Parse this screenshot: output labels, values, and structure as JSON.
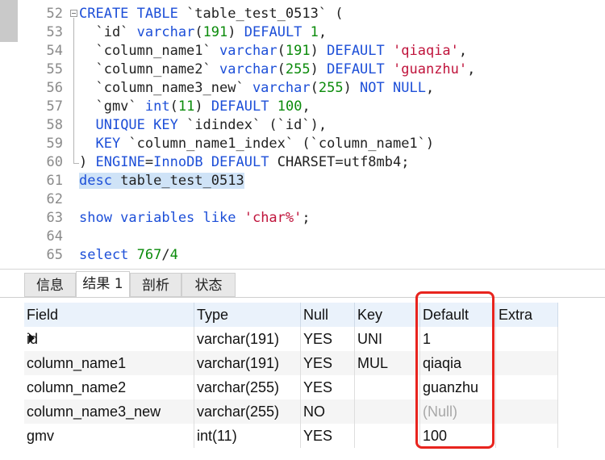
{
  "editor": {
    "lines": [
      {
        "n": "52",
        "html": "<span class='kw'>CREATE TABLE</span> `table_test_0513` ("
      },
      {
        "n": "53",
        "html": "  `id` <span class='kw'>varchar</span>(<span class='num'>191</span>) <span class='kw'>DEFAULT</span> <span class='num'>1</span>,"
      },
      {
        "n": "54",
        "html": "  `column_name1` <span class='kw'>varchar</span>(<span class='num'>191</span>) <span class='kw'>DEFAULT</span> <span class='str'>'qiaqia'</span>,"
      },
      {
        "n": "55",
        "html": "  `column_name2` <span class='kw'>varchar</span>(<span class='num'>255</span>) <span class='kw'>DEFAULT</span> <span class='str'>'guanzhu'</span>,"
      },
      {
        "n": "56",
        "html": "  `column_name3_new` <span class='kw'>varchar</span>(<span class='num'>255</span>) <span class='kw'>NOT NULL</span>,"
      },
      {
        "n": "57",
        "html": "  `gmv` <span class='kw'>int</span>(<span class='num'>11</span>) <span class='kw'>DEFAULT</span> <span class='num'>100</span>,"
      },
      {
        "n": "58",
        "html": "  <span class='kw'>UNIQUE KEY</span> `idindex` (`id`),"
      },
      {
        "n": "59",
        "html": "  <span class='kw'>KEY</span> `column_name1_index` (`column_name1`)"
      },
      {
        "n": "60",
        "html": ") <span class='kw'>ENGINE</span>=<span class='kw'>InnoDB</span> <span class='kw'>DEFAULT</span> CHARSET=utf8mb4;"
      },
      {
        "n": "61",
        "html": "<span class='hl'><span class='kw'>desc</span> table_test_0513</span>"
      },
      {
        "n": "62",
        "html": ""
      },
      {
        "n": "63",
        "html": "<span class='kw'>show variables like</span> <span class='str'>'char%'</span>;"
      },
      {
        "n": "64",
        "html": ""
      },
      {
        "n": "65",
        "html": "<span class='kw'>select</span> <span class='num'>767</span>/<span class='num'>4</span>"
      }
    ]
  },
  "tabs": [
    "信息",
    "结果 1",
    "剖析",
    "状态"
  ],
  "active_tab": "结果 1",
  "grid": {
    "columns": [
      "Field",
      "Type",
      "Null",
      "Key",
      "Default",
      "Extra"
    ],
    "rows": [
      [
        "id",
        "varchar(191)",
        "YES",
        "UNI",
        "1",
        ""
      ],
      [
        "column_name1",
        "varchar(191)",
        "YES",
        "MUL",
        "qiaqia",
        ""
      ],
      [
        "column_name2",
        "varchar(255)",
        "YES",
        "",
        "guanzhu",
        ""
      ],
      [
        "column_name3_new",
        "varchar(255)",
        "NO",
        "",
        "(Null)",
        ""
      ],
      [
        "gmv",
        "int(11)",
        "YES",
        "",
        "100",
        ""
      ]
    ]
  },
  "highlight_color": "#e8241e",
  "keyword_color": "#1d4fd8"
}
